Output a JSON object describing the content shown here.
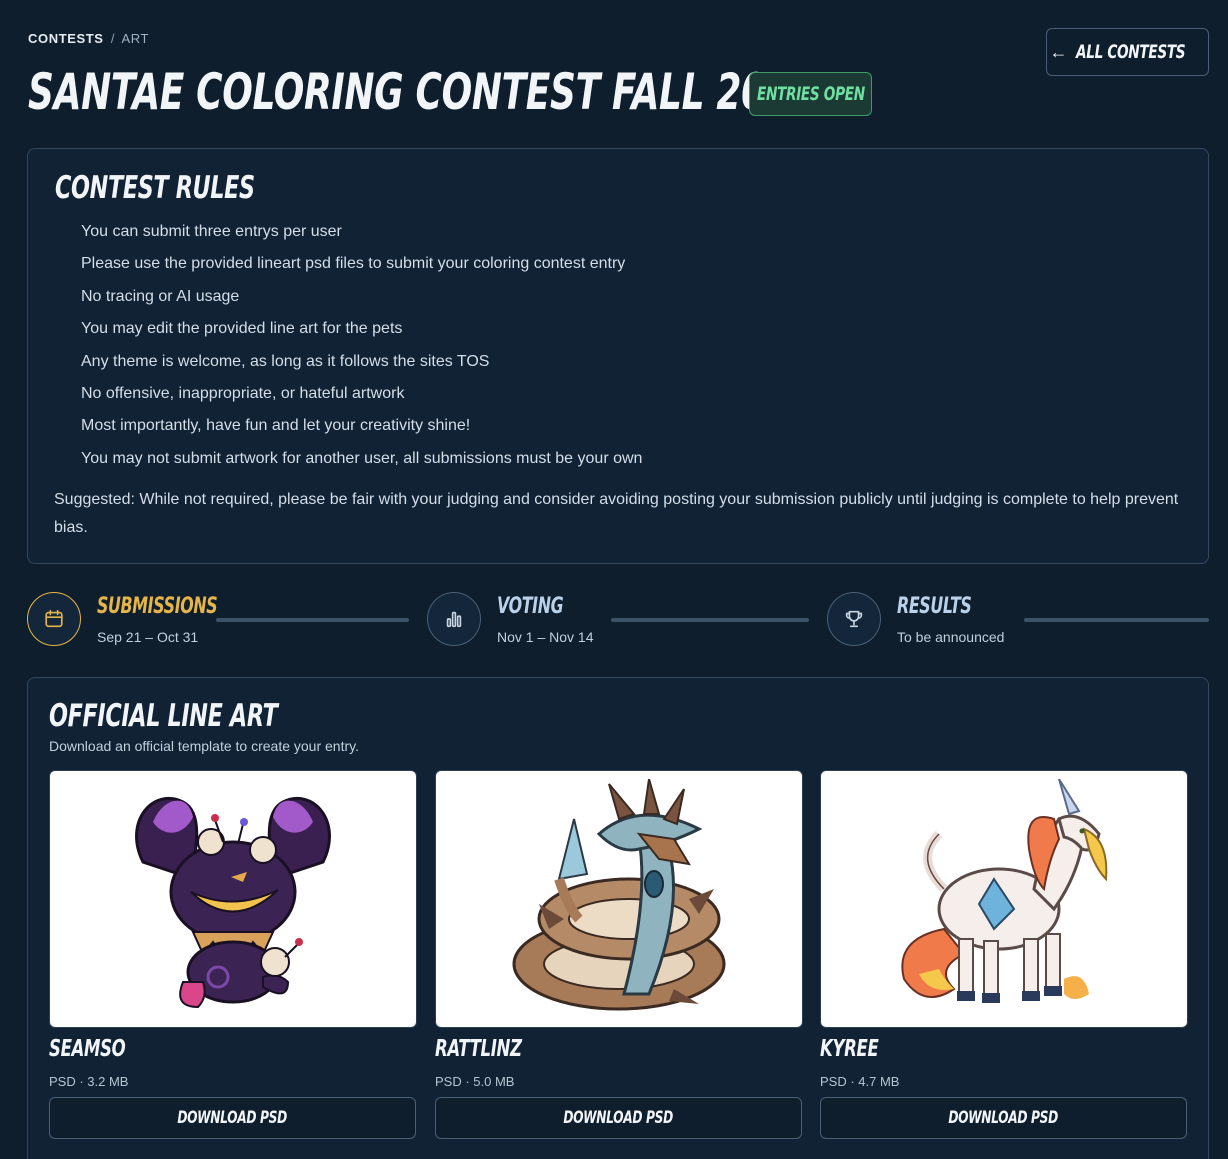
{
  "breadcrumb": {
    "root": "CONTESTS",
    "separator": "/",
    "current": "ART"
  },
  "page_title": "SANTAE COLORING CONTEST FALL 2026",
  "status_badge": "ENTRIES OPEN",
  "back_button": "ALL CONTESTS",
  "rules": {
    "title": "CONTEST RULES",
    "items": [
      "You can submit three entrys per user",
      "Please use the provided lineart psd files to submit your coloring contest entry",
      "No tracing or AI usage",
      "You may edit the provided line art for the pets",
      "Any theme is welcome, as long as it follows the sites TOS",
      "No offensive, inappropriate, or hateful artwork",
      "Most importantly, have fun and let your creativity shine!",
      "You may not submit artwork for another user, all submissions must be your own"
    ],
    "note": "Suggested: While not required, please be fair with your judging and consider avoiding posting your submission publicly until judging is complete to help prevent bias."
  },
  "timeline": [
    {
      "title": "SUBMISSIONS",
      "date": "Sep 21 – Oct 31",
      "icon": "calendar-icon",
      "active": true
    },
    {
      "title": "VOTING",
      "date": "Nov 1 – Nov 14",
      "icon": "bar-chart-icon",
      "active": false
    },
    {
      "title": "RESULTS",
      "date": "To be announced",
      "icon": "trophy-icon",
      "active": false
    }
  ],
  "line_art": {
    "title": "OFFICIAL LINE ART",
    "subtitle": "Download an official template to create your entry.",
    "cards": [
      {
        "name": "SEAMSO",
        "meta": "PSD · 3.2 MB",
        "button": "DOWNLOAD PSD"
      },
      {
        "name": "RATTLINZ",
        "meta": "PSD · 5.0 MB",
        "button": "DOWNLOAD PSD"
      },
      {
        "name": "KYREE",
        "meta": "PSD · 4.7 MB",
        "button": "DOWNLOAD PSD"
      }
    ]
  },
  "colors": {
    "background": "#0f1e2c",
    "panel": "#112235",
    "active_accent": "#e5b54a",
    "step_accent": "#b9d2ea",
    "badge_green": "#6fe0a1"
  }
}
